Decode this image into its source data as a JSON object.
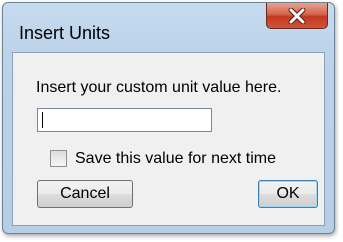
{
  "dialog": {
    "title": "Insert Units",
    "close_icon": "close-icon"
  },
  "form": {
    "prompt": "Insert your custom unit value here.",
    "input_value": "",
    "checkbox_label": "Save this value for next time",
    "checkbox_checked": false
  },
  "buttons": {
    "cancel_label": "Cancel",
    "ok_label": "OK"
  },
  "colors": {
    "frame": "#bcd3ea",
    "close_button": "#c2381f",
    "client_area": "#f0f0f0",
    "default_button_border": "#3c7fb1"
  }
}
